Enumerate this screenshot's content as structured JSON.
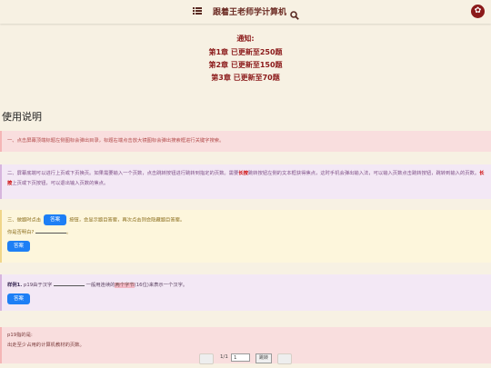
{
  "header": {
    "title": "跟着王老师学计算机",
    "menu_icon": "menu-icon",
    "search_icon": "search-icon",
    "settings_icon": "gear-icon",
    "brand_color": "#8b1a1a"
  },
  "notice": {
    "title": "通知:",
    "lines": [
      "第1章 已更新至250题",
      "第2章 已更新至150题",
      "第3章 已更新至70题"
    ]
  },
  "section": {
    "title": "使用说明"
  },
  "card1": {
    "text": "一、点击屏幕顶端标题左侧图标会弹出目录，标题右端点击放大镜图标会弹出搜索框进行关键字搜索。"
  },
  "card2": {
    "text_a": "二、屏幕底端可以进行上页或下页换页。如果需要输入一个页数，点击跳转按钮进行跳转到指定的页数。需要",
    "emph1": "长按",
    "text_b": "跳转按钮左侧的文本框获得焦点，这时手机会弹出输入法，可以输入页数点击跳转按钮，跳转到输入的页数。",
    "emph2": "长按",
    "text_c": "上页或下页按钮，可以退出输入页数的焦点。"
  },
  "card3": {
    "text_a": "三、做题时点击",
    "inline_button": "答案",
    "text_b": "按钮，会显示题目答案，再次点击则会隐藏题目答案。",
    "line2": "你是否明白?",
    "line2_end": "。",
    "button": "答案"
  },
  "card4": {
    "label": "样例1.",
    "text_a": "p19由于汉字",
    "text_b": "一般用连续的",
    "highlight": "两个字节",
    "text_c": "(16位)来表示一个汉字。",
    "button": "答案"
  },
  "card5": {
    "line1": "p19指的是:",
    "line2": "出走至少占用的计算机教材的页数。"
  },
  "pager": {
    "page": "1/1",
    "input_value": "1",
    "go_label": "跳转"
  }
}
